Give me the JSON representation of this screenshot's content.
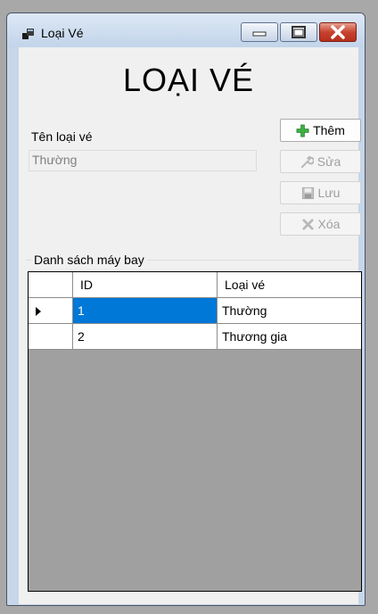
{
  "window": {
    "title": "Loại Vé",
    "icon": "app-window-icon"
  },
  "heading": "LOẠI VÉ",
  "form": {
    "type_label": "Tên loại vé",
    "type_value": "Thường"
  },
  "buttons": {
    "add": {
      "label": "Thêm",
      "icon": "plus-icon",
      "color": "#3cb043"
    },
    "edit": {
      "label": "Sửa",
      "icon": "wrench-icon"
    },
    "save": {
      "label": "Lưu",
      "icon": "floppy-disk-icon"
    },
    "delete": {
      "label": "Xóa",
      "icon": "x-icon"
    }
  },
  "group": {
    "label": "Danh sách máy bay"
  },
  "grid": {
    "columns": [
      "ID",
      "Loại vé"
    ],
    "rows": [
      {
        "id": "1",
        "type": "Thường",
        "selected": true
      },
      {
        "id": "2",
        "type": "Thương gia",
        "selected": false
      }
    ],
    "selection_color": "#0078d7"
  }
}
